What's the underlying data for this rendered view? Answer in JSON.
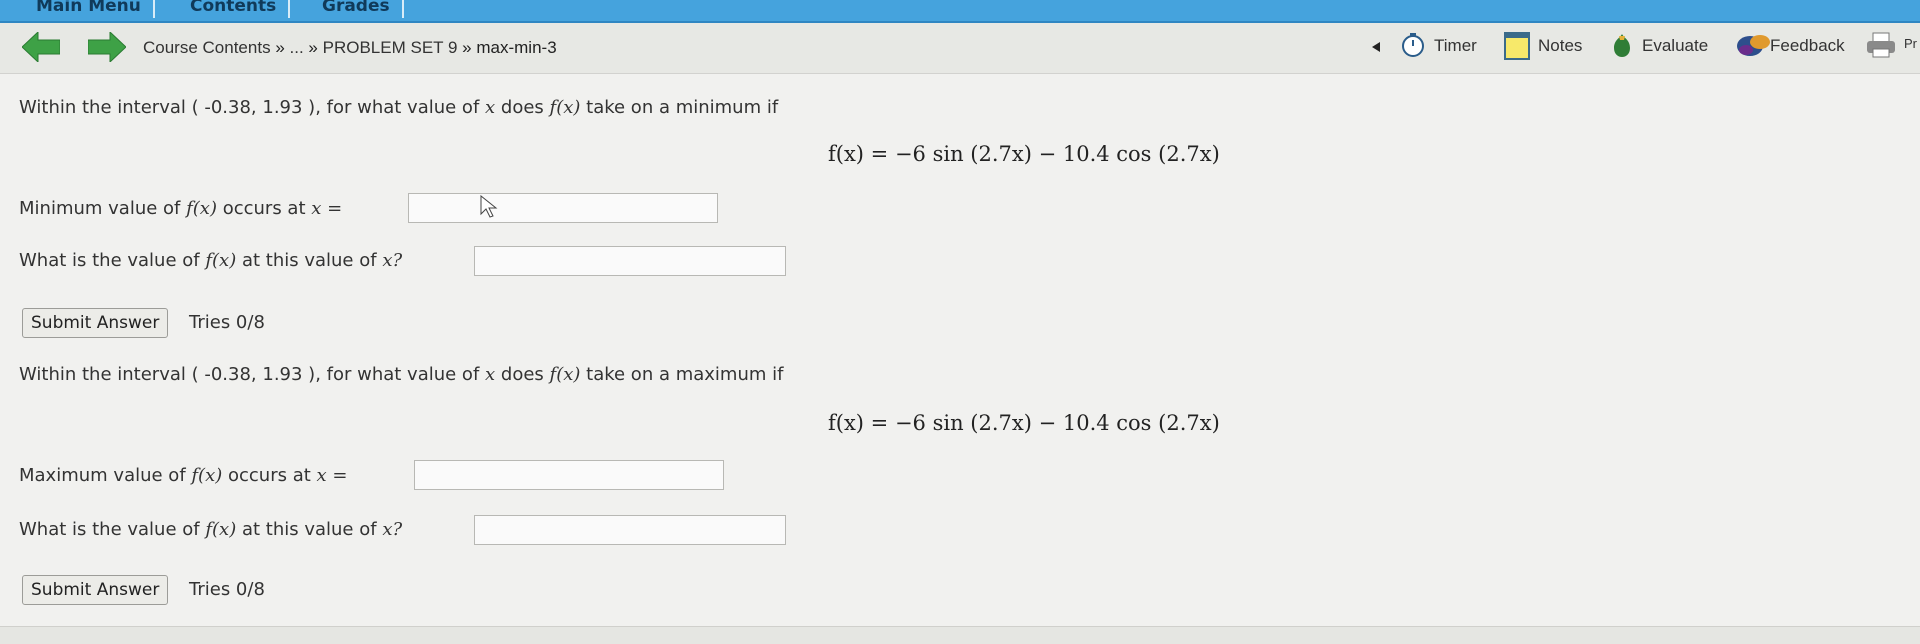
{
  "topbar": {
    "tabs": [
      "Main Menu",
      "Contents",
      "Grades"
    ]
  },
  "breadcrumb": {
    "course_contents": "Course Contents",
    "sep1": "»",
    "ellipsis": "...",
    "sep2": "»",
    "problem_set": "PROBLEM SET 9",
    "sep3": "»",
    "current": "max-min-3"
  },
  "tools": {
    "timer": "Timer",
    "notes": "Notes",
    "evaluate": "Evaluate",
    "feedback": "Feedback",
    "print": "Pr"
  },
  "part1": {
    "prompt_a": "Within the interval ( -0.38, 1.93 ), for what value of",
    "prompt_var": "x",
    "prompt_b": "does",
    "prompt_fx": "f(x)",
    "prompt_c": "take on a minimum if",
    "formula": "f(x) = −6 sin (2.7x) − 10.4 cos (2.7x)",
    "q1_a": "Minimum value of",
    "q1_fx": "f(x)",
    "q1_b": "occurs at",
    "q1_var": "x =",
    "q2_a": "What is the value of",
    "q2_fx": "f(x)",
    "q2_b": "at this value of",
    "q2_var": "x?",
    "submit_label": "Submit Answer",
    "tries": "Tries 0/8"
  },
  "part2": {
    "prompt_a": "Within the interval ( -0.38, 1.93 ), for what value of",
    "prompt_var": "x",
    "prompt_b": "does",
    "prompt_fx": "f(x)",
    "prompt_c": "take on a maximum if",
    "formula": "f(x) = −6 sin (2.7x) − 10.4 cos (2.7x)",
    "q1_a": "Maximum value of",
    "q1_fx": "f(x)",
    "q1_b": "occurs at",
    "q1_var": "x =",
    "q2_a": "What is the value of",
    "q2_fx": "f(x)",
    "q2_b": "at this value of",
    "q2_var": "x?",
    "submit_label": "Submit Answer",
    "tries": "Tries 0/8"
  },
  "colors": {
    "topbar": "#45a3dd",
    "nav_arrow": "#3ea146",
    "navbar_bg": "#e7e8e4",
    "page_bg": "#f1f1ef"
  }
}
